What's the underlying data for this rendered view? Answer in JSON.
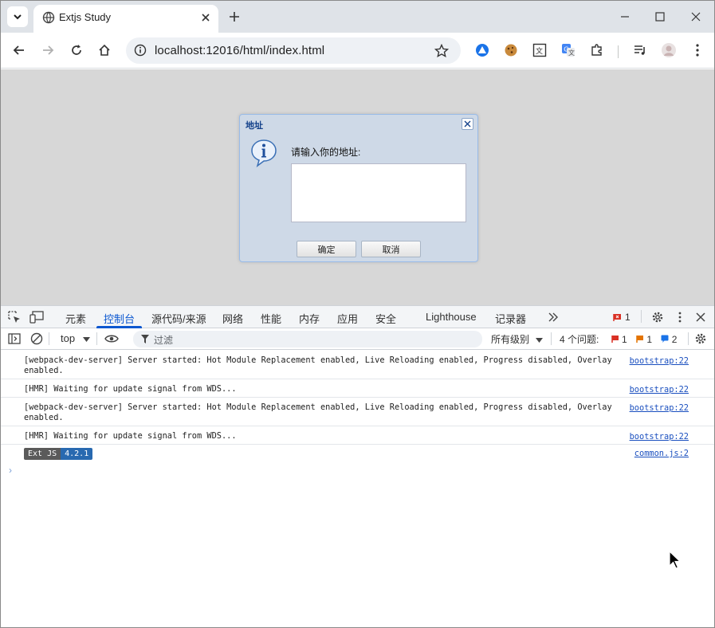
{
  "browser": {
    "tab_title": "Extjs Study",
    "url": "localhost:12016/html/index.html"
  },
  "dialog": {
    "title": "地址",
    "message": "请输入你的地址:",
    "textarea_value": "",
    "ok_label": "确定",
    "cancel_label": "取消"
  },
  "devtools": {
    "tabs": [
      "元素",
      "控制台",
      "源代码/来源",
      "网络",
      "性能",
      "内存",
      "应用",
      "安全",
      "Lighthouse",
      "记录器"
    ],
    "active_tab": "控制台",
    "error_count": "1",
    "context": "top",
    "filter_placeholder": "过滤",
    "levels_label": "所有级别",
    "issues_label": "4 个问题:",
    "issue_errors": "1",
    "issue_warnings": "1",
    "issue_info": "2",
    "logs": [
      {
        "text": "[webpack-dev-server] Server started: Hot Module Replacement enabled, Live Reloading enabled, Progress disabled, Overlay enabled.",
        "source": "bootstrap:22"
      },
      {
        "text": "[HMR] Waiting for update signal from WDS...",
        "source": "bootstrap:22"
      },
      {
        "text": "[webpack-dev-server] Server started: Hot Module Replacement enabled, Live Reloading enabled, Progress disabled, Overlay enabled.",
        "source": "bootstrap:22"
      },
      {
        "text": "[HMR] Waiting for update signal from WDS...",
        "source": "bootstrap:22"
      }
    ],
    "extjs_badge": {
      "name": "Ext JS",
      "version": "4.2.1",
      "source": "common.js:2"
    },
    "prompt_symbol": "›"
  },
  "colors": {
    "accent": "#0b57d0",
    "page_bg": "#d7d7d7",
    "dialog_bg": "#ced9e7",
    "dialog_title": "#15428b"
  }
}
